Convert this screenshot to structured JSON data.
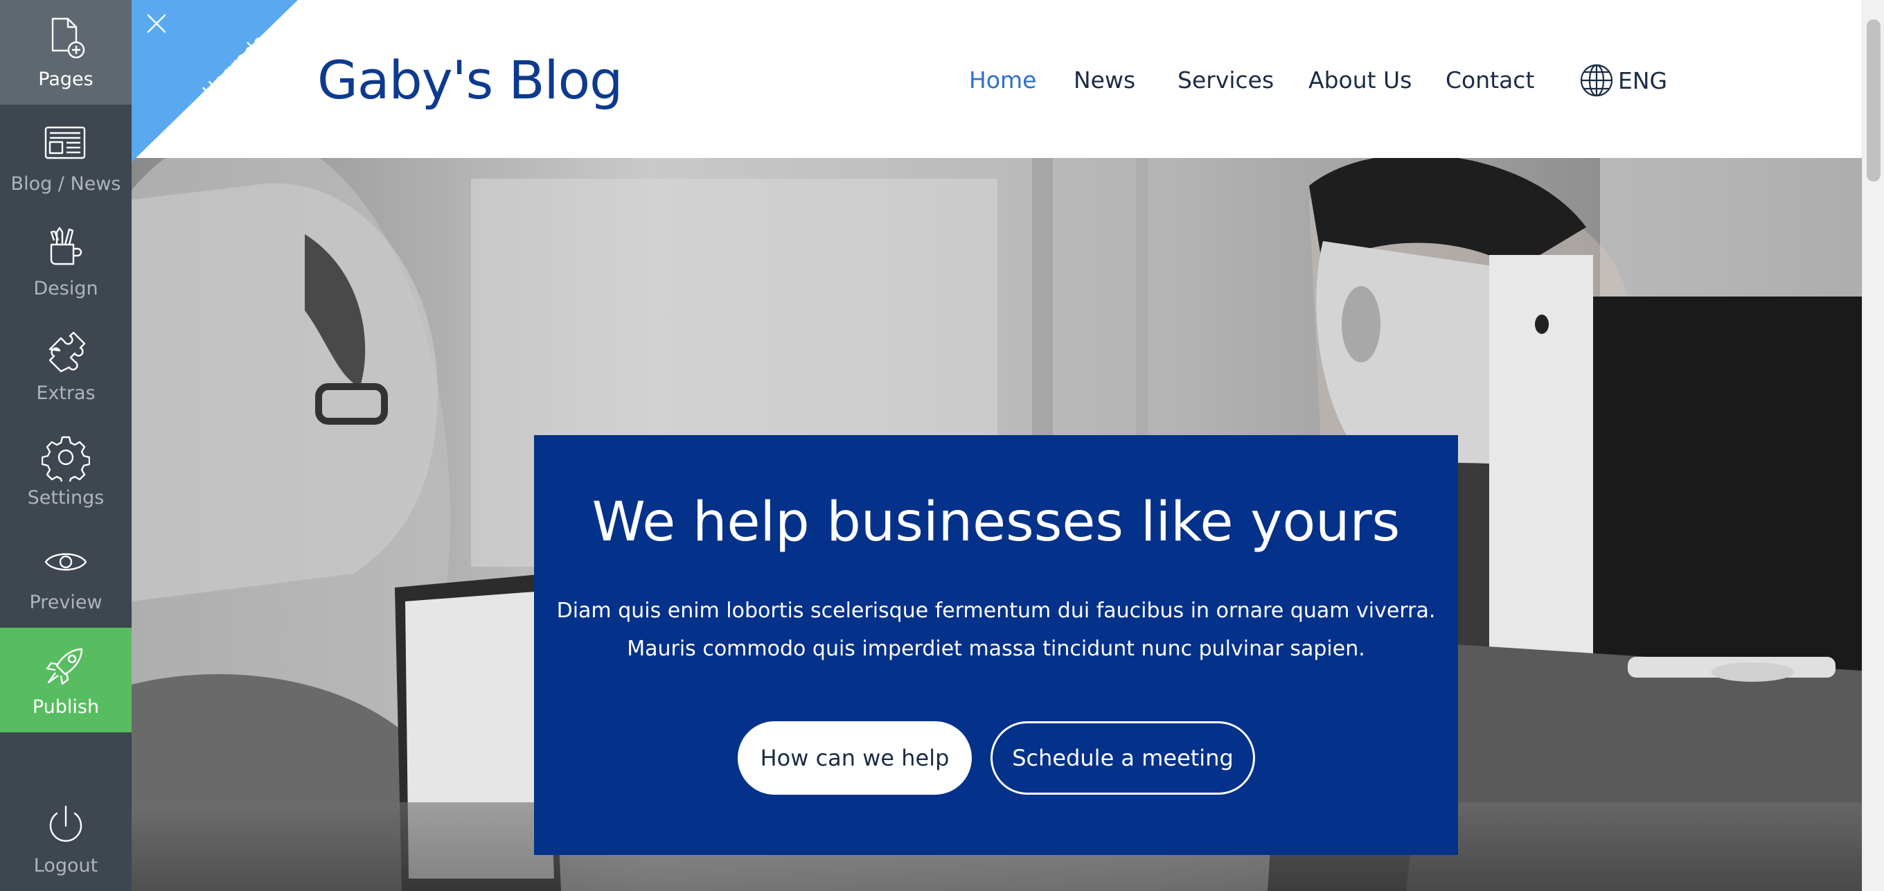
{
  "sidebar": {
    "items": [
      {
        "label": "Pages",
        "icon": "add-page-icon",
        "active": true
      },
      {
        "label": "Blog / News",
        "icon": "newspaper-icon"
      },
      {
        "label": "Design",
        "icon": "design-tools-icon"
      },
      {
        "label": "Extras",
        "icon": "puzzle-icon"
      },
      {
        "label": "Settings",
        "icon": "gear-icon"
      },
      {
        "label": "Preview",
        "icon": "eye-icon"
      },
      {
        "label": "Publish",
        "icon": "rocket-icon"
      }
    ],
    "logout": {
      "label": "Logout",
      "icon": "power-icon"
    },
    "colors": {
      "background": "#3e4650",
      "active": "#5f6870",
      "publish": "#58bd60",
      "text": "#aeb5bd"
    }
  },
  "premium": {
    "line1": "Upgrade",
    "line2": "to Premium",
    "color": "#5aa9f0"
  },
  "site": {
    "logo": "Gaby's Blog",
    "nav": [
      "Home",
      "News",
      "Services",
      "About Us",
      "Contact"
    ],
    "current_nav": "Home",
    "language": "ENG",
    "colors": {
      "brand": "#0c3a8f",
      "nav_active": "#2f6fc9",
      "nav_text": "#1b2b46"
    }
  },
  "hero": {
    "title": "We help businesses like yours",
    "text_line1": "Diam quis enim lobortis scelerisque fermentum dui faucibus in ornare quam viverra.",
    "text_line2": "Mauris commodo quis imperdiet massa tincidunt nunc pulvinar sapien.",
    "primary_button": "How can we help",
    "secondary_button": "Schedule a meeting",
    "card_color": "#04318a"
  }
}
